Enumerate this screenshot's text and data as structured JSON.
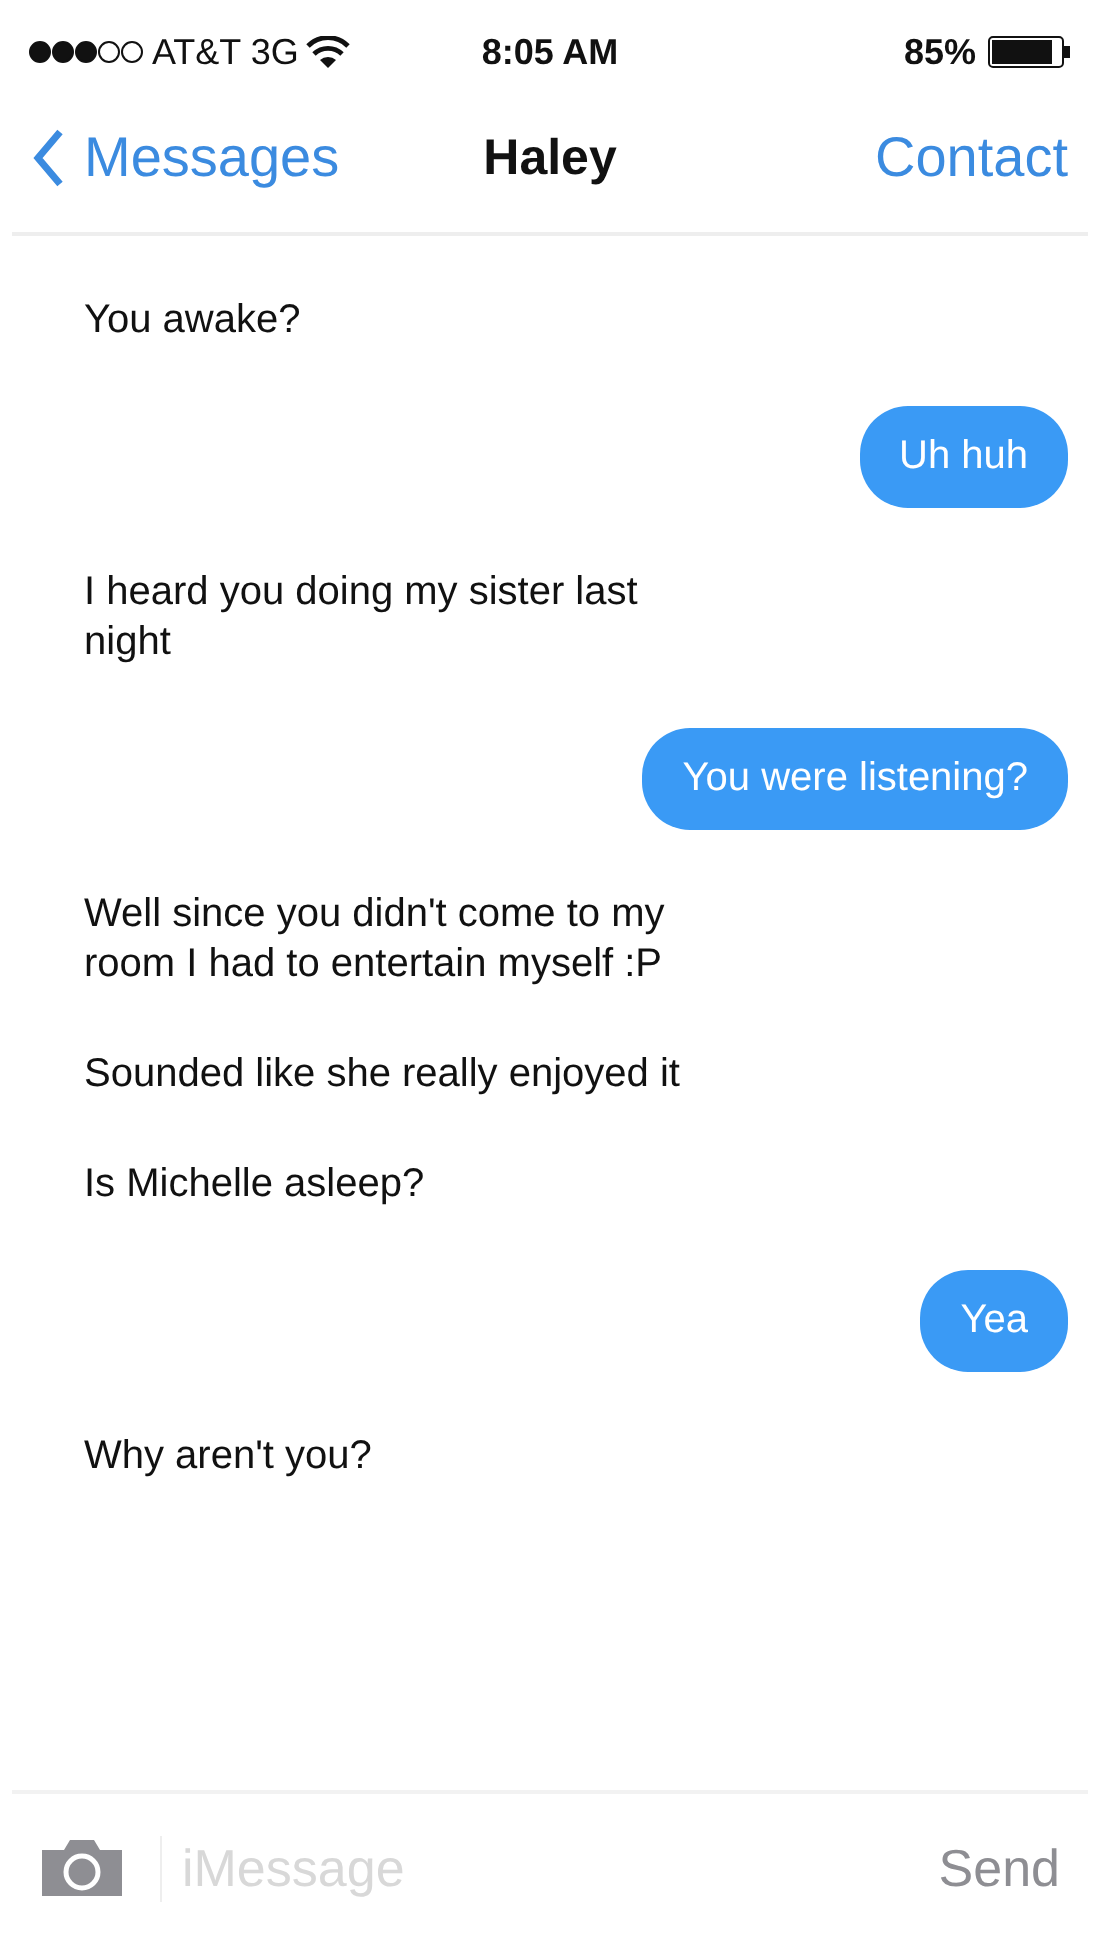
{
  "status_bar": {
    "carrier": "AT&T 3G",
    "time": "8:05 AM",
    "battery": "85%"
  },
  "nav": {
    "back": "Messages",
    "title": "Haley",
    "action": "Contact"
  },
  "messages": [
    {
      "kind": "incoming",
      "text": "You awake?"
    },
    {
      "kind": "outgoing",
      "text": "Uh huh"
    },
    {
      "kind": "incoming",
      "text": "I heard you doing my sister last night"
    },
    {
      "kind": "outgoing",
      "text": "You were listening?"
    },
    {
      "kind": "incoming",
      "text": "Well since you didn't come to my room I had to entertain myself :P"
    },
    {
      "kind": "incoming",
      "text": "Sounded like she really enjoyed it"
    },
    {
      "kind": "incoming",
      "text": "Is Michelle asleep?"
    },
    {
      "kind": "outgoing",
      "text": "Yea"
    },
    {
      "kind": "incoming",
      "text": "Why aren't you?"
    }
  ],
  "composer": {
    "placeholder": "iMessage",
    "send": "Send"
  }
}
